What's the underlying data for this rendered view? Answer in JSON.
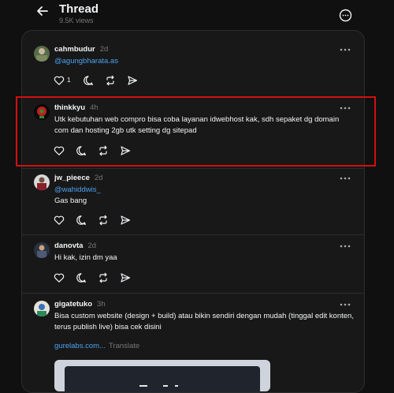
{
  "header": {
    "title": "Thread",
    "subtitle": "9.5K views"
  },
  "posts": [
    {
      "username": "cahmbudur",
      "time": "2d",
      "mention": "@agungbharata.as",
      "text": "",
      "like_count": "1"
    },
    {
      "username": "thinkkyu",
      "time": "4h",
      "mention": "",
      "text": "Utk kebutuhan web compro bisa coba layanan idwebhost kak, sdh sepaket dg domain com dan hosting 2gb utk setting dg sitepad",
      "like_count": ""
    },
    {
      "username": "jw_pieece",
      "time": "2d",
      "mention": "@wahiddwis_",
      "text": "Gas bang",
      "like_count": ""
    },
    {
      "username": "danovta",
      "time": "2d",
      "mention": "",
      "text": "Hi kak, izin dm yaa",
      "like_count": ""
    },
    {
      "username": "gigatetuko",
      "time": "3h",
      "mention": "",
      "text": "Bisa custom website (design + build) atau bikin sendiri dengan mudah (tinggal edit konten, terus publish live) bisa cek disini",
      "link": "gurelabs.com...",
      "translate": "Translate"
    }
  ],
  "colors": {
    "background": "#101010",
    "panel": "#181818",
    "link": "#4aa3f0",
    "highlight": "#d20f0f"
  }
}
